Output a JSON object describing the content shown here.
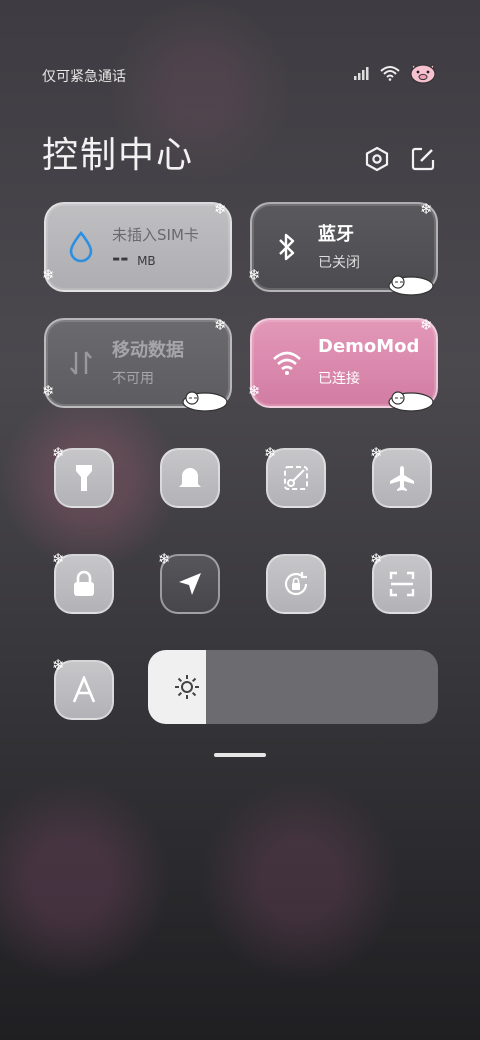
{
  "status_bar": {
    "carrier_text": "仅可紧急通话",
    "icons": [
      "signal-icon",
      "wifi-icon",
      "pig-face-icon"
    ]
  },
  "header": {
    "title": "控制中心",
    "settings_icon": "settings-hexagon-icon",
    "edit_icon": "edit-icon"
  },
  "tiles": {
    "mobile_usage": {
      "title": "未插入SIM卡",
      "value": "--",
      "unit": "MB",
      "icon": "water-drop-icon"
    },
    "bluetooth": {
      "title": "蓝牙",
      "status": "已关闭",
      "icon": "bluetooth-icon"
    },
    "mobile_data": {
      "title": "移动数据",
      "status": "不可用",
      "icon": "data-arrows-icon"
    },
    "wifi": {
      "title": "DemoMod",
      "status": "已连接",
      "icon": "wifi-icon",
      "color": "#d983aa"
    }
  },
  "quick_toggles": [
    {
      "name": "flashlight",
      "icon": "flashlight-icon",
      "active": false
    },
    {
      "name": "ring",
      "icon": "bell-icon",
      "active": false
    },
    {
      "name": "screenshot",
      "icon": "scissors-icon",
      "active": false
    },
    {
      "name": "airplane",
      "icon": "airplane-icon",
      "active": false
    },
    {
      "name": "lock-screen",
      "icon": "lock-icon",
      "active": false
    },
    {
      "name": "location",
      "icon": "location-arrow-icon",
      "active": true
    },
    {
      "name": "rotation-lock",
      "icon": "rotation-lock-icon",
      "active": false
    },
    {
      "name": "scanner",
      "icon": "scan-icon",
      "active": false
    },
    {
      "name": "font-size",
      "icon": "font-a-icon",
      "active": false
    }
  ],
  "brightness": {
    "level": 0.2,
    "icon": "sun-icon"
  },
  "colors": {
    "pink_accent": "#d983aa",
    "tile_light": "#b8b8bb",
    "tile_dark": "#525155"
  }
}
